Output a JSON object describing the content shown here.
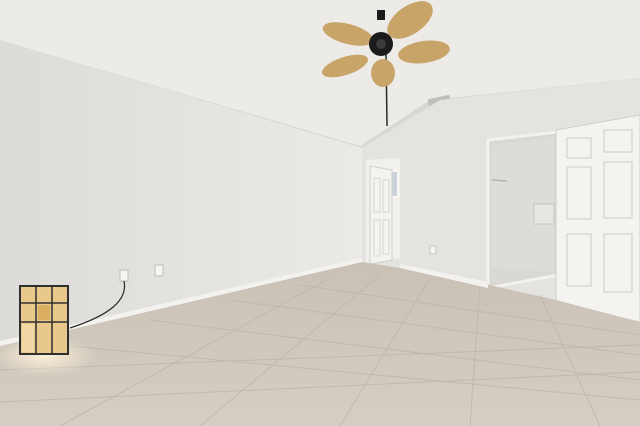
{
  "scene": {
    "room": "empty-bedroom",
    "elements": [
      "ceiling",
      "ceiling-fan",
      "air-vent",
      "left-wall",
      "back-wall",
      "open-doorway",
      "interior-door",
      "closet-opening",
      "closet-door",
      "floor-tile",
      "baseboard",
      "wall-outlet",
      "floor-lamp"
    ],
    "colors": {
      "ceiling": "#ecebe8",
      "wall": "#e6e5e2",
      "wall_shadow": "#d7d6d3",
      "floor": "#cfc7bd",
      "grout": "#bdb5aa",
      "door": "#f4f3f0",
      "fan_blade": "#c8a468",
      "fan_body": "#1c1c1c",
      "lamp_glow": "#e8c98b"
    }
  }
}
